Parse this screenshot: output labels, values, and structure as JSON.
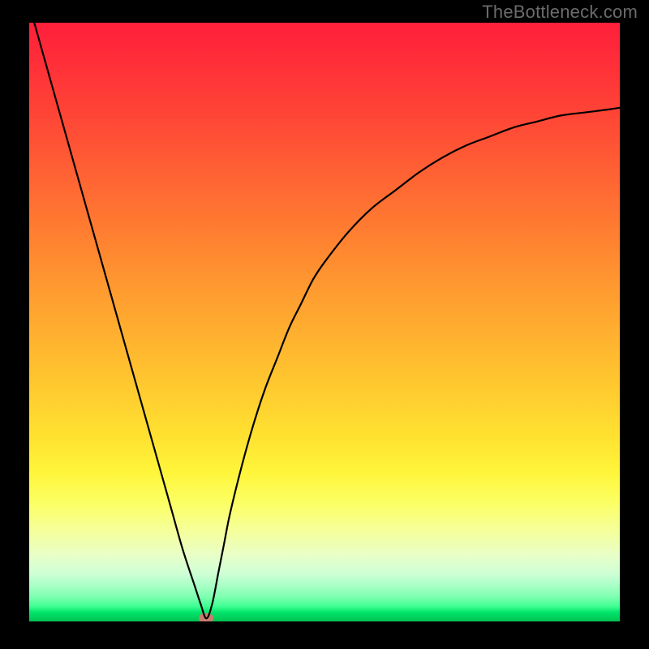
{
  "watermark": "TheBottleneck.com",
  "chart_data": {
    "type": "line",
    "title": "",
    "xlabel": "",
    "ylabel": "",
    "xlim": [
      0,
      100
    ],
    "ylim": [
      0,
      100
    ],
    "grid": false,
    "legend": false,
    "series": [
      {
        "name": "bottleneck-curve",
        "x": [
          0,
          2,
          4,
          6,
          8,
          10,
          12,
          14,
          16,
          18,
          20,
          22,
          24,
          26,
          28,
          29,
          30,
          31,
          32,
          33,
          34,
          36,
          38,
          40,
          42,
          44,
          46,
          48,
          50,
          54,
          58,
          62,
          66,
          70,
          74,
          78,
          82,
          86,
          90,
          94,
          98,
          100
        ],
        "y": [
          103,
          96,
          89,
          82,
          75,
          68,
          61,
          54,
          47,
          40,
          33,
          26,
          19,
          12,
          6,
          3,
          0.5,
          3,
          8,
          13,
          18,
          26,
          33,
          39,
          44,
          49,
          53,
          57,
          60,
          65,
          69,
          72,
          75,
          77.5,
          79.5,
          81,
          82.5,
          83.5,
          84.5,
          85,
          85.5,
          85.8
        ]
      }
    ],
    "min_point": {
      "x": 30,
      "y": 0.5
    },
    "gradient_meaning": "red (high bottleneck) at top to green (low bottleneck) at bottom"
  },
  "colors": {
    "background": "#000000",
    "curve": "#000000",
    "marker": "#c97b6e",
    "watermark": "#6b6b6b"
  }
}
